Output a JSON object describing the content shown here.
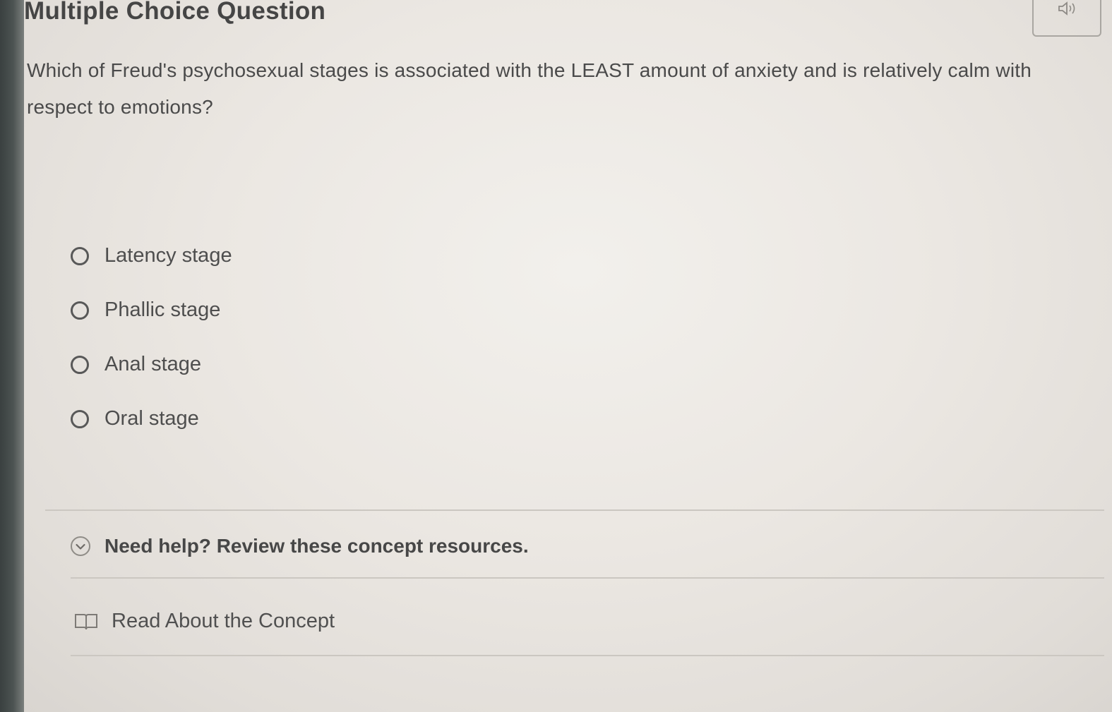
{
  "header": {
    "title": "Multiple Choice Question",
    "audio_icon": "speaker-icon"
  },
  "question": {
    "text": "Which of Freud's psychosexual stages is associated with the LEAST amount of anxiety and is relatively calm with respect to emotions?"
  },
  "options": [
    {
      "label": "Latency stage",
      "selected": false
    },
    {
      "label": "Phallic stage",
      "selected": false
    },
    {
      "label": "Anal stage",
      "selected": false
    },
    {
      "label": "Oral stage",
      "selected": false
    }
  ],
  "help": {
    "label": "Need help? Review these concept resources.",
    "icon": "chevron-down-circle-icon",
    "expanded": true
  },
  "resources": {
    "read_label": "Read About the Concept",
    "icon": "book-icon"
  },
  "colors": {
    "background": "#ebe7e2",
    "text": "#4a4a4a",
    "divider": "#cbc7c1"
  }
}
